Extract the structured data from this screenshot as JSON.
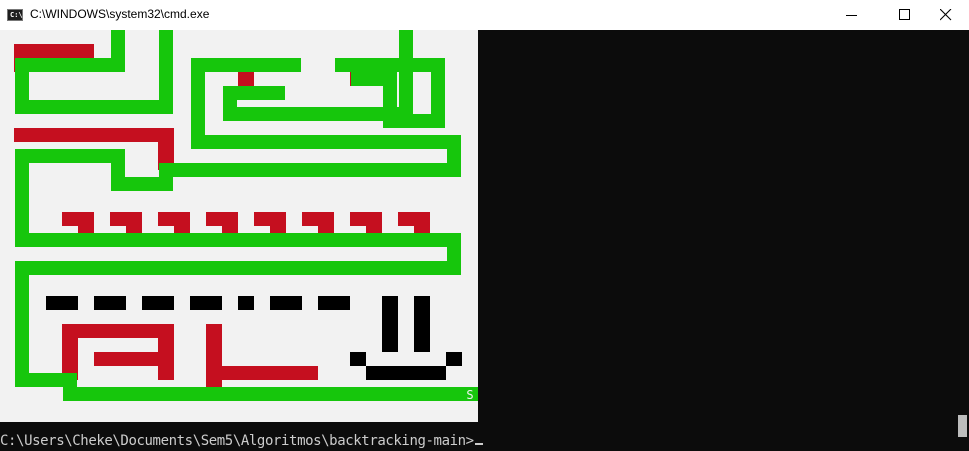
{
  "window": {
    "title": "C:\\WINDOWS\\system32\\cmd.exe",
    "icon": "cmd-icon",
    "icon_label": "C:\\",
    "controls": [
      "minimize-icon",
      "maximize-icon",
      "close-icon"
    ]
  },
  "colors": {
    "titlebar": "#ffffff",
    "console_bg": "#0c0c0c",
    "maze_bg": "#f2f2f2",
    "path": "#16c60c",
    "wall": "#c50f1f",
    "face": "#000000",
    "prompt_text": "#cccccc"
  },
  "maze": {
    "exit_marker": "S"
  },
  "console": {
    "prompt": "C:\\Users\\Cheke\\Documents\\Sem5\\Algoritmos\\backtracking-main>"
  }
}
